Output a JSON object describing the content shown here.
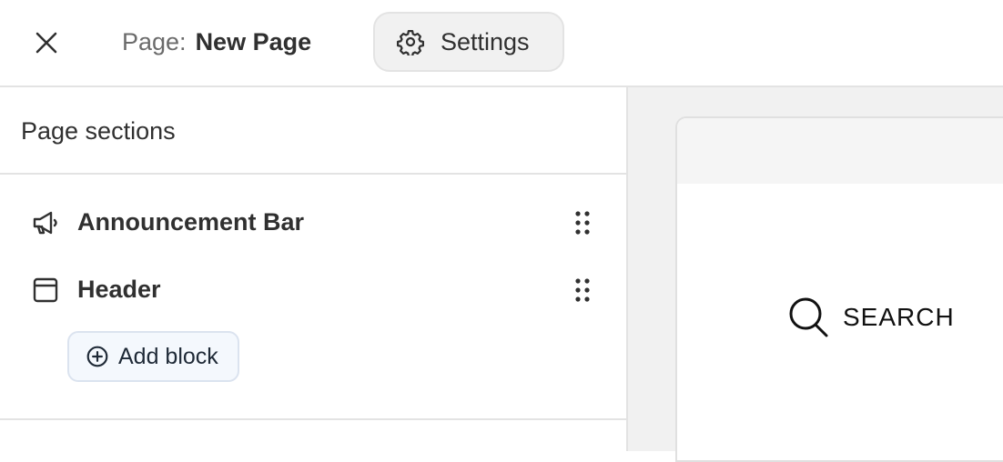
{
  "topbar": {
    "close_icon": "close-icon",
    "page_prefix": "Page:",
    "page_name": "New Page",
    "settings_label": "Settings",
    "settings_icon": "gear-icon"
  },
  "sidebar": {
    "title": "Page sections",
    "sections": [
      {
        "label": "Announcement Bar",
        "icon": "megaphone-icon"
      },
      {
        "label": "Header",
        "icon": "window-icon"
      }
    ],
    "add_block_label": "Add block",
    "add_block_icon": "plus-circle-icon"
  },
  "preview": {
    "search_label": "SEARCH",
    "search_icon": "search-icon"
  }
}
